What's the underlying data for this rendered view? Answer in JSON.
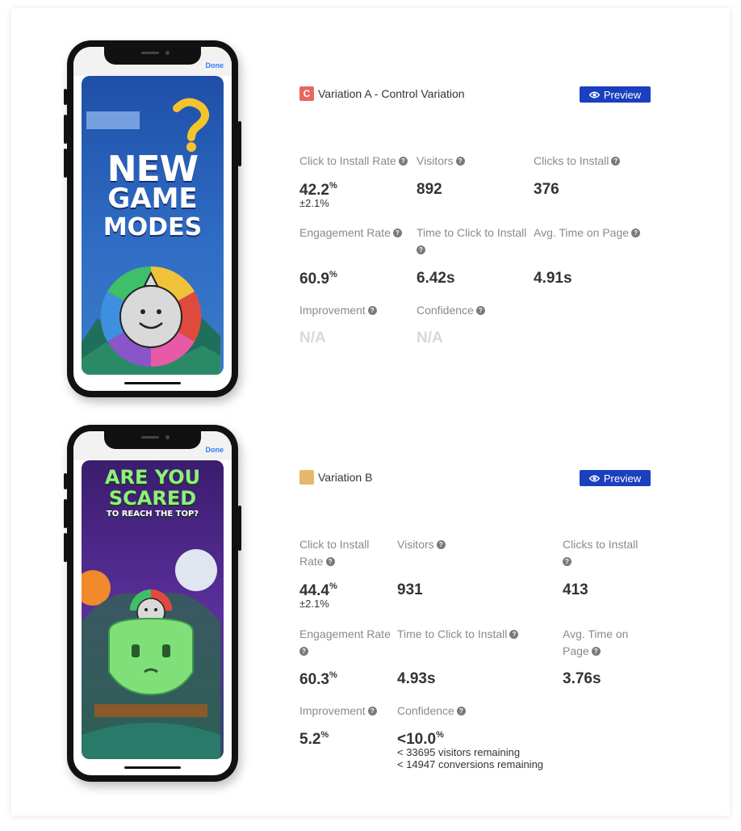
{
  "variations": [
    {
      "badge": "C",
      "name": "Variation A - Control Variation",
      "preview_label": "Preview",
      "swatch_color": "#e8685f",
      "phone": {
        "done_label": "Done",
        "ad_text": [
          "NEW",
          "GAME",
          "MODES"
        ]
      },
      "metrics": {
        "click_to_install_rate": {
          "label": "Click to Install Rate",
          "value": "42.2",
          "unit": "%",
          "sub": "±2.1%"
        },
        "visitors": {
          "label": "Visitors",
          "value": "892"
        },
        "clicks_to_install": {
          "label": "Clicks to Install",
          "value": "376"
        },
        "engagement_rate": {
          "label": "Engagement Rate",
          "value": "60.9",
          "unit": "%"
        },
        "time_to_click_to_install": {
          "label": "Time to Click to Install",
          "value": "6.42s"
        },
        "avg_time_on_page": {
          "label": "Avg. Time on Page",
          "value": "4.91s"
        },
        "improvement": {
          "label": "Improvement",
          "value": "N/A"
        },
        "confidence": {
          "label": "Confidence",
          "value": "N/A"
        }
      }
    },
    {
      "badge": "",
      "name": "Variation B",
      "preview_label": "Preview",
      "swatch_color": "#e3b86a",
      "phone": {
        "done_label": "Done",
        "ad_text": [
          "ARE YOU",
          "SCARED",
          "TO REACH THE TOP?"
        ]
      },
      "metrics": {
        "click_to_install_rate": {
          "label": "Click to Install Rate",
          "value": "44.4",
          "unit": "%",
          "sub": "±2.1%"
        },
        "visitors": {
          "label": "Visitors",
          "value": "931"
        },
        "clicks_to_install": {
          "label": "Clicks to Install",
          "value": "413"
        },
        "engagement_rate": {
          "label": "Engagement Rate",
          "value": "60.3",
          "unit": "%"
        },
        "time_to_click_to_install": {
          "label": "Time to Click to Install",
          "value": "4.93s"
        },
        "avg_time_on_page": {
          "label": "Avg. Time on Page",
          "value": "3.76s"
        },
        "improvement": {
          "label": "Improvement",
          "value": "5.2",
          "unit": "%"
        },
        "confidence": {
          "label": "Confidence",
          "value": "<10.0",
          "unit": "%",
          "note1": "< 33695 visitors remaining",
          "note2": "< 14947 conversions remaining"
        }
      }
    }
  ],
  "colors": {
    "preview_button": "#1a3fbf",
    "label_gray": "#8a8a8a",
    "na_gray": "#d8d8d8"
  }
}
